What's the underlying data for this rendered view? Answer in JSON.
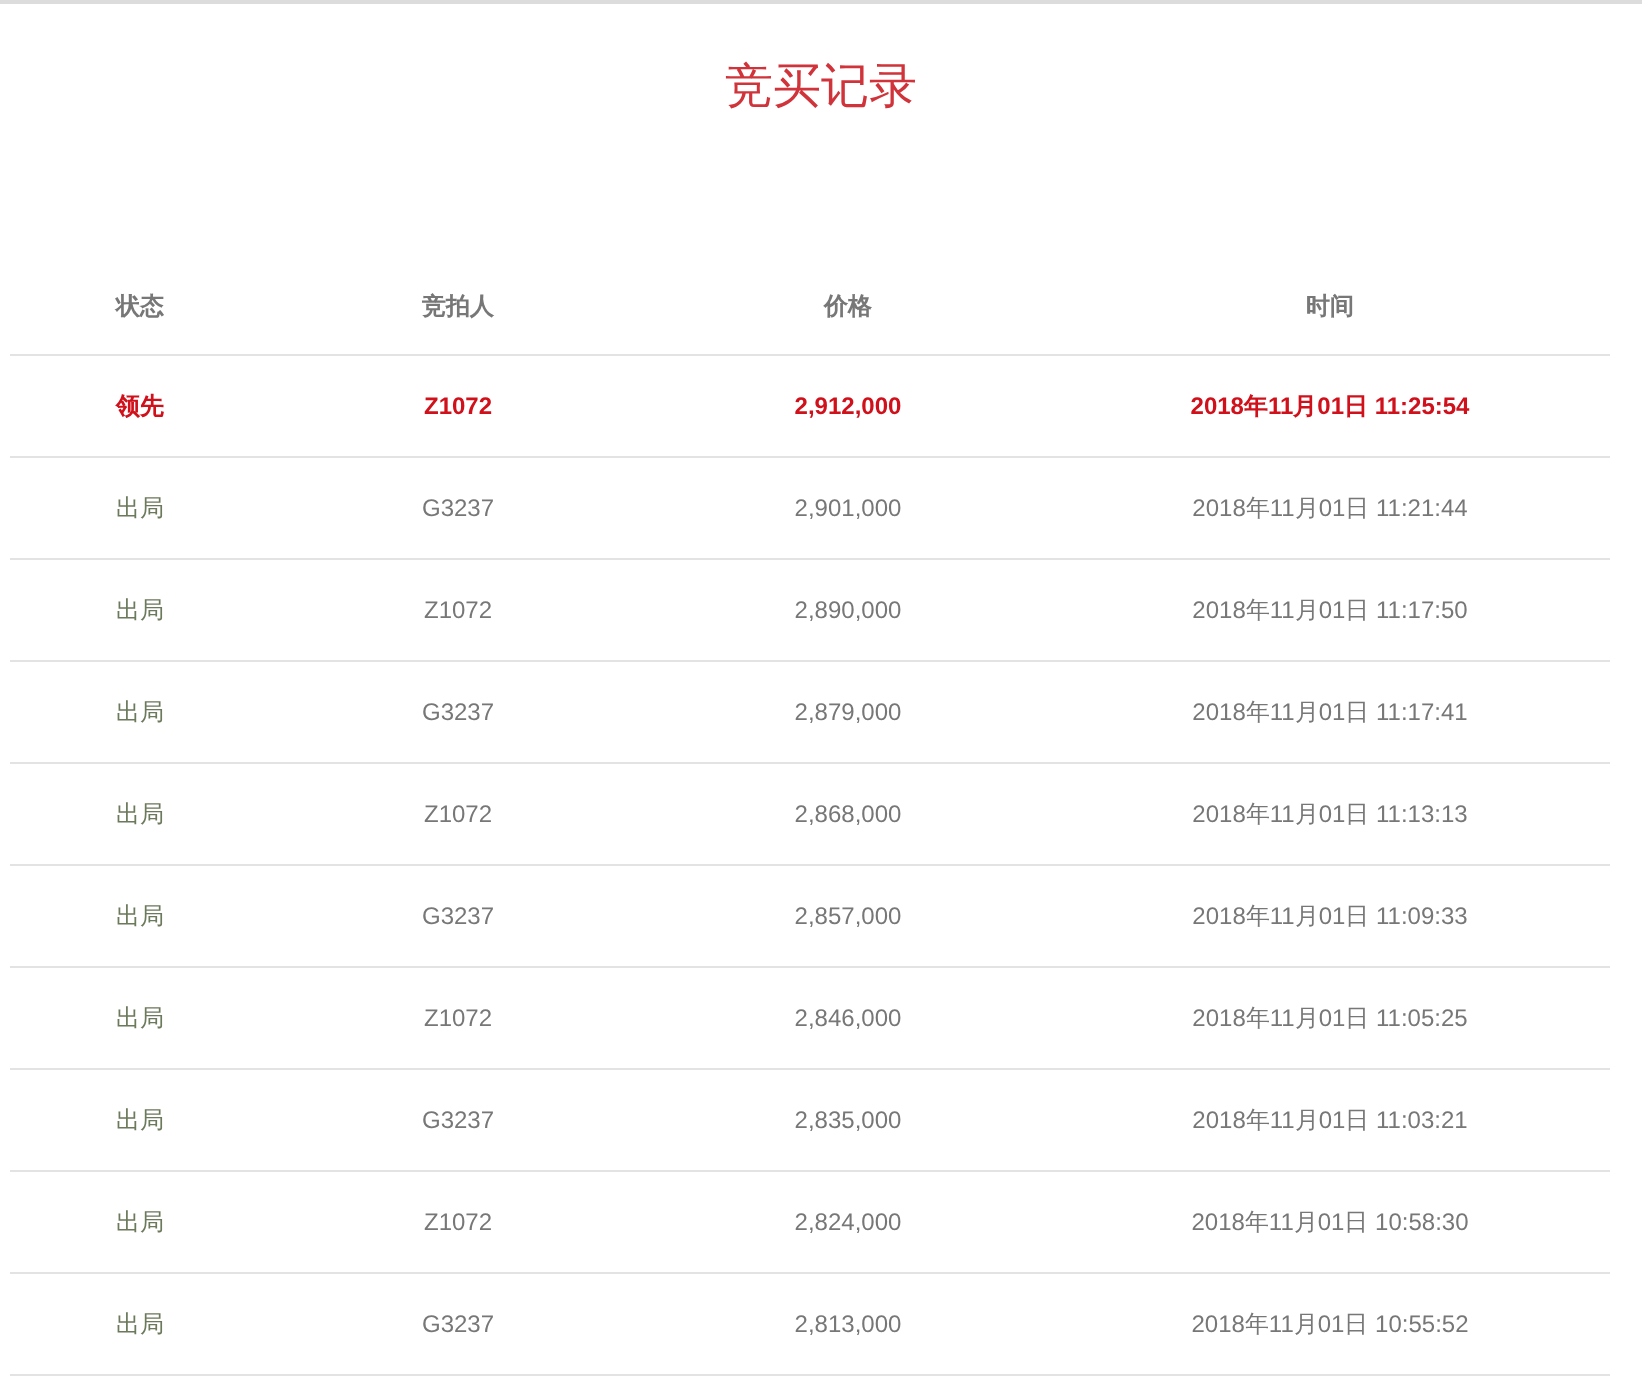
{
  "title": "竞买记录",
  "columns": [
    "状态",
    "竞拍人",
    "价格",
    "时间"
  ],
  "rows": [
    {
      "status": "领先",
      "bidder": "Z1072",
      "price": "2,912,000",
      "time": "2018年11月01日 11:25:54",
      "leading": true
    },
    {
      "status": "出局",
      "bidder": "G3237",
      "price": "2,901,000",
      "time": "2018年11月01日 11:21:44",
      "leading": false
    },
    {
      "status": "出局",
      "bidder": "Z1072",
      "price": "2,890,000",
      "time": "2018年11月01日 11:17:50",
      "leading": false
    },
    {
      "status": "出局",
      "bidder": "G3237",
      "price": "2,879,000",
      "time": "2018年11月01日 11:17:41",
      "leading": false
    },
    {
      "status": "出局",
      "bidder": "Z1072",
      "price": "2,868,000",
      "time": "2018年11月01日 11:13:13",
      "leading": false
    },
    {
      "status": "出局",
      "bidder": "G3237",
      "price": "2,857,000",
      "time": "2018年11月01日 11:09:33",
      "leading": false
    },
    {
      "status": "出局",
      "bidder": "Z1072",
      "price": "2,846,000",
      "time": "2018年11月01日 11:05:25",
      "leading": false
    },
    {
      "status": "出局",
      "bidder": "G3237",
      "price": "2,835,000",
      "time": "2018年11月01日 11:03:21",
      "leading": false
    },
    {
      "status": "出局",
      "bidder": "Z1072",
      "price": "2,824,000",
      "time": "2018年11月01日 10:58:30",
      "leading": false
    },
    {
      "status": "出局",
      "bidder": "G3237",
      "price": "2,813,000",
      "time": "2018年11月01日 10:55:52",
      "leading": false
    }
  ]
}
